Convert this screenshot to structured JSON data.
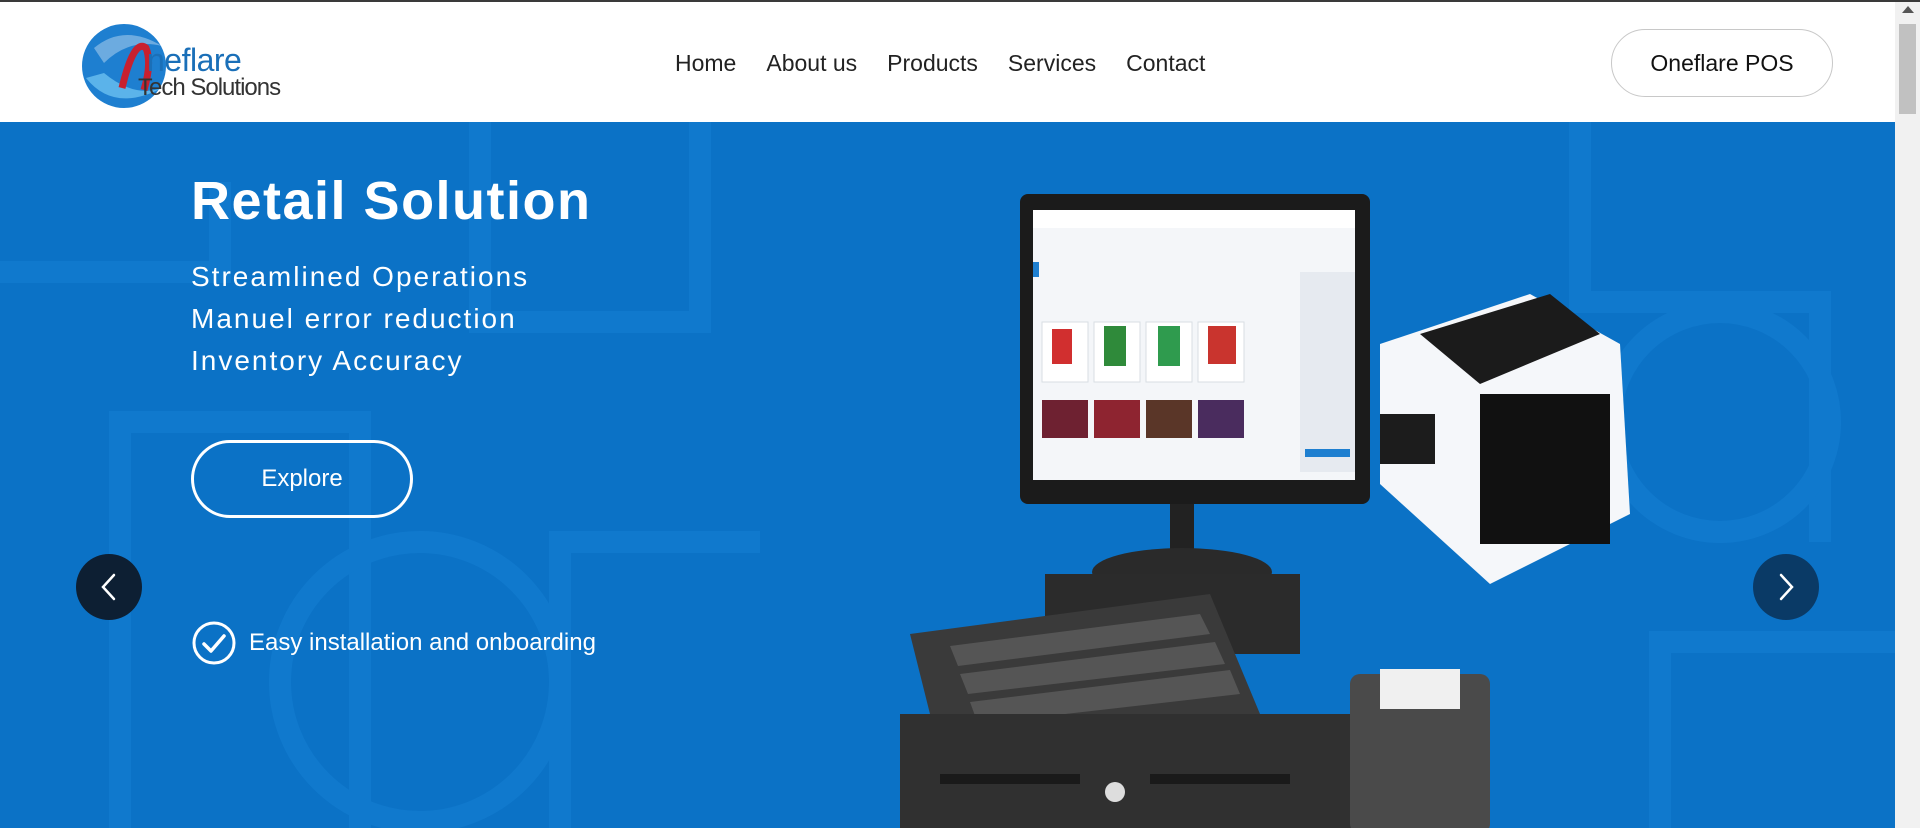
{
  "brand": {
    "logo_text_1": "neflare",
    "logo_text_2": "Tech Solutions",
    "colors": {
      "primary": "#0b72c6",
      "logo_blue": "#1a6fb8",
      "logo_red": "#c8202f"
    }
  },
  "nav": {
    "items": [
      {
        "label": "Home"
      },
      {
        "label": "About us"
      },
      {
        "label": "Products"
      },
      {
        "label": "Services"
      },
      {
        "label": "Contact"
      }
    ],
    "cta_label": "Oneflare POS"
  },
  "hero": {
    "title": "Retail Solution",
    "lines": [
      "Streamlined Operations",
      "Manuel error reduction",
      "Inventory Accuracy"
    ],
    "button_label": "Explore",
    "feature": "Easy installation and onboarding"
  },
  "icons": {
    "prev": "chevron-left-icon",
    "next": "chevron-right-icon",
    "feature": "check-circle-icon"
  }
}
